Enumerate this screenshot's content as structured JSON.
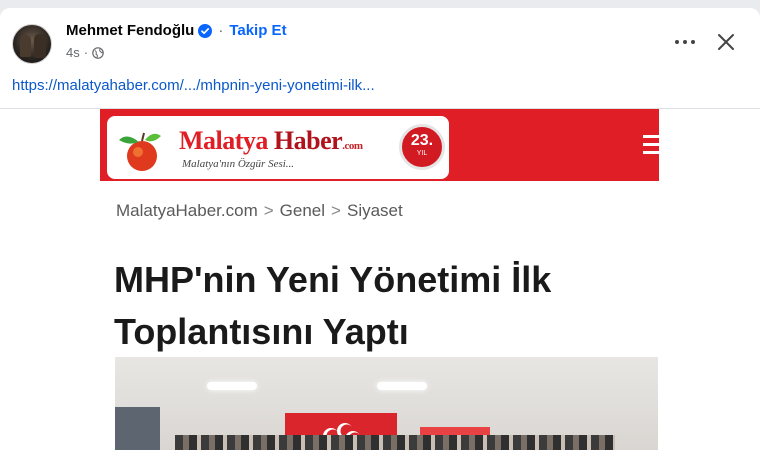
{
  "post": {
    "author": "Mehmet Fendoğlu",
    "separator": "·",
    "follow_label": "Takip Et",
    "time": "4s",
    "meta_separator": "·",
    "link": "https://malatyahaber.com/.../mhpnin-yeni-yonetimi-ilk..."
  },
  "article": {
    "site_name_1": "Malatya",
    "site_name_2": "Haber",
    "site_tld": ".com",
    "slogan": "Malatya'nın Özgür Sesi...",
    "badge_number": "23.",
    "badge_label": "YIL",
    "breadcrumb": [
      "MalatyaHaber.com",
      "Genel",
      "Siyaset"
    ],
    "breadcrumb_sep": ">",
    "title": "MHP'nin Yeni Yönetimi İlk Toplantısını Yaptı"
  },
  "icons": {
    "verified": "verified-badge-icon",
    "globe": "globe-icon",
    "more": "more-options-icon",
    "close": "close-icon",
    "menu": "hamburger-menu-icon"
  },
  "colors": {
    "accent": "#0866ff",
    "link": "#0a58ca",
    "brand_red": "#e01e25"
  }
}
